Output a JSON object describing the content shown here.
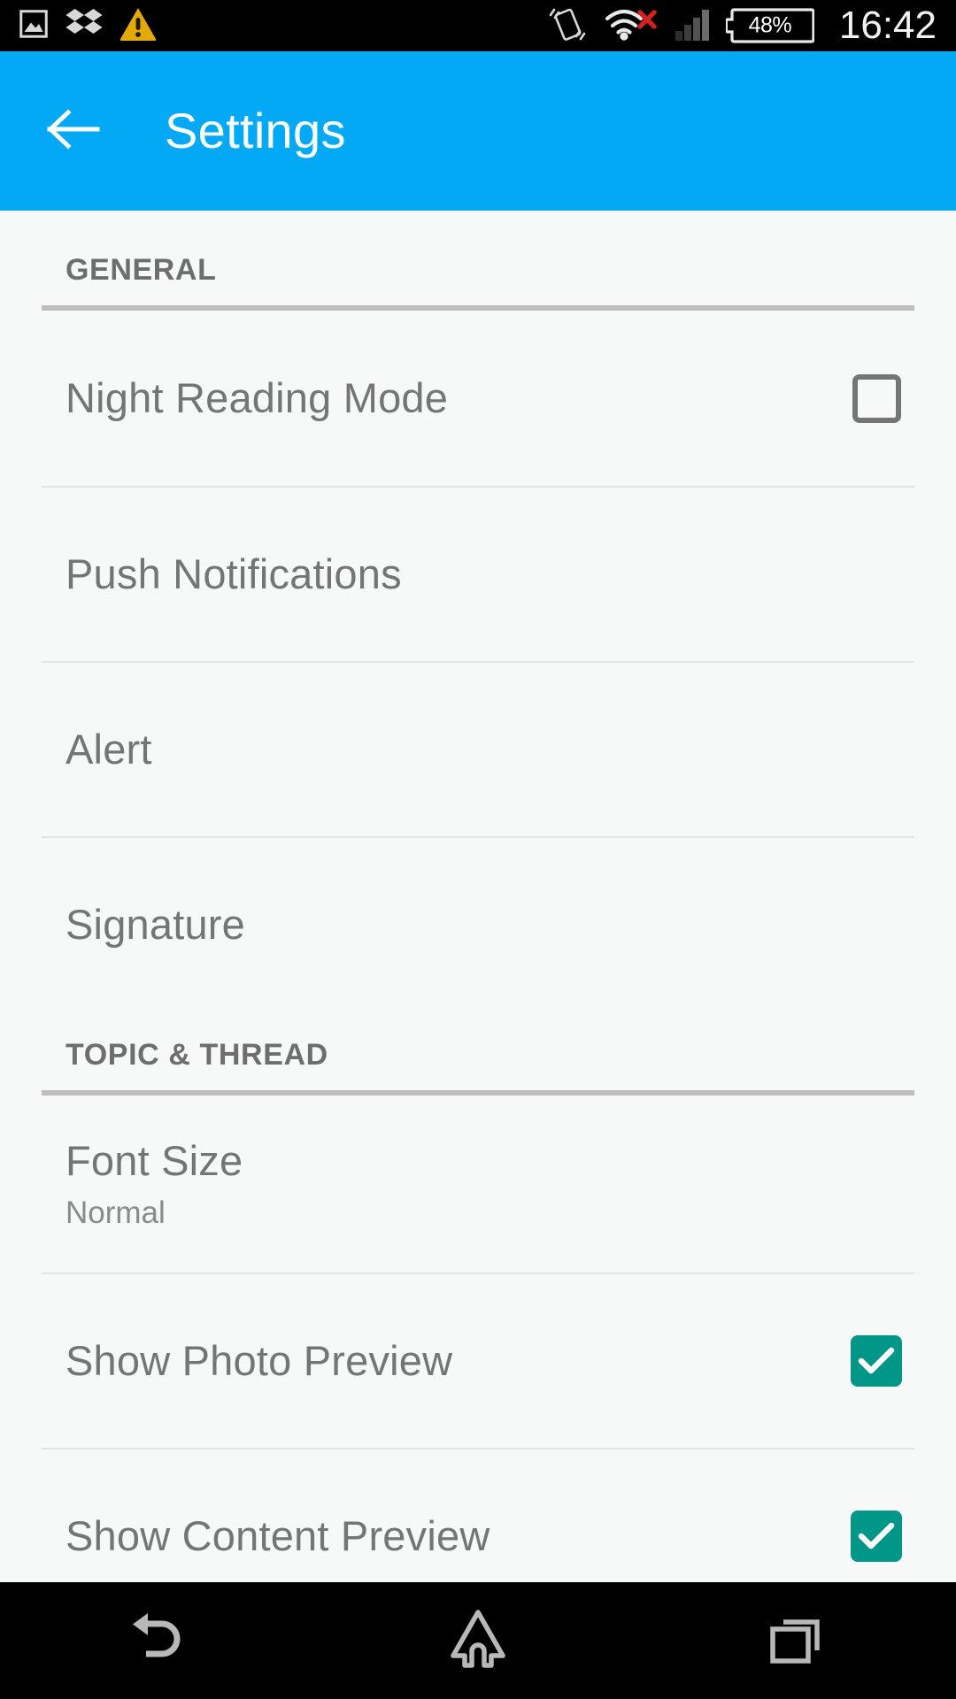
{
  "status_bar": {
    "left_icons": [
      {
        "name": "photo-icon",
        "label": "Photo"
      },
      {
        "name": "dropbox-icon",
        "label": "Dropbox"
      },
      {
        "name": "warning-icon",
        "label": "Warning"
      }
    ],
    "right_icons": [
      {
        "name": "vibrate-icon",
        "label": "Vibrate"
      },
      {
        "name": "wifi-icon",
        "label": "Wi-Fi"
      },
      {
        "name": "no-signal-x-icon",
        "label": "No service"
      },
      {
        "name": "cellular-signal-icon",
        "label": "Signal"
      }
    ],
    "battery_percent": "48%",
    "clock": "16:42"
  },
  "app_bar": {
    "back_icon": "back-arrow-icon",
    "title": "Settings",
    "background_color": "#03a9f4",
    "title_color": "#ffffff"
  },
  "sections": [
    {
      "header": "GENERAL",
      "rows": [
        {
          "title": "Night Reading Mode",
          "subtitle": "",
          "control": "checkbox",
          "checked": false
        },
        {
          "title": "Push Notifications",
          "subtitle": "",
          "control": "none",
          "checked": null
        },
        {
          "title": "Alert",
          "subtitle": "",
          "control": "none",
          "checked": null
        },
        {
          "title": "Signature",
          "subtitle": "",
          "control": "none",
          "checked": null
        }
      ]
    },
    {
      "header": "TOPIC & THREAD",
      "rows": [
        {
          "title": "Font Size",
          "subtitle": "Normal",
          "control": "none",
          "checked": null
        },
        {
          "title": "Show Photo Preview",
          "subtitle": "",
          "control": "checkbox",
          "checked": true
        },
        {
          "title": "Show Content Preview",
          "subtitle": "",
          "control": "checkbox",
          "checked": true
        }
      ]
    }
  ],
  "colors": {
    "accent": "#03a9f4",
    "checkbox_checked": "#009688",
    "checkbox_unchecked": "#757575",
    "page_background": "#f7f8f8",
    "row_title": "#757575",
    "section_header": "#6e6e6e",
    "divider": "#e2e3e3",
    "section_rule": "#bdbdbd",
    "status_bar_background": "#000000",
    "warning_icon": "#e2a907",
    "no_signal_x": "#d32020"
  },
  "nav_bar": {
    "buttons": [
      {
        "name": "nav-back-button",
        "label": "Back"
      },
      {
        "name": "nav-home-button",
        "label": "Home"
      },
      {
        "name": "nav-recents-button",
        "label": "Recent apps"
      }
    ]
  }
}
